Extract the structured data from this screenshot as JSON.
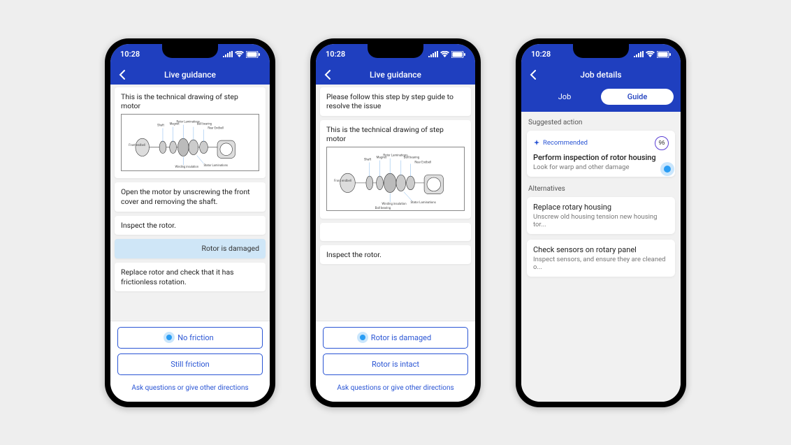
{
  "status": {
    "time": "10:28"
  },
  "phone1": {
    "header_title": "Live guidance",
    "msg_drawing": "This is the technical drawing of step motor",
    "msg_open": "Open the motor by unscrewing the front cover and removing the shaft.",
    "msg_inspect": "Inspect the rotor.",
    "reply_damaged": "Rotor is damaged",
    "msg_replace": "Replace rotor and check that it has frictionless rotation.",
    "option_a": "No friction",
    "option_b": "Still friction",
    "ask": "Ask questions or give other directions"
  },
  "phone2": {
    "header_title": "Live guidance",
    "msg_follow": "Please follow this step by step guide to resolve the issue",
    "msg_drawing": "This is the technical drawing of step motor",
    "msg_inspect": "Inspect the rotor.",
    "option_a": "Rotor is damaged",
    "option_b": "Rotor is intact",
    "ask": "Ask questions or give other directions"
  },
  "phone3": {
    "header_title": "Job details",
    "tab_job": "Job",
    "tab_guide": "Guide",
    "section_suggested": "Suggested action",
    "rec_badge": "Recommended",
    "rec_score": "96",
    "rec_title": "Perform inspection of rotor housing",
    "rec_sub": "Look for warp and other damage",
    "section_alt": "Alternatives",
    "alt1_title": "Replace rotary housing",
    "alt1_sub": "Unscrew old housing tension new housing tor...",
    "alt2_title": "Check sensors on rotary panel",
    "alt2_sub": "Inspect sensors, and ensure they are cleaned o..."
  }
}
